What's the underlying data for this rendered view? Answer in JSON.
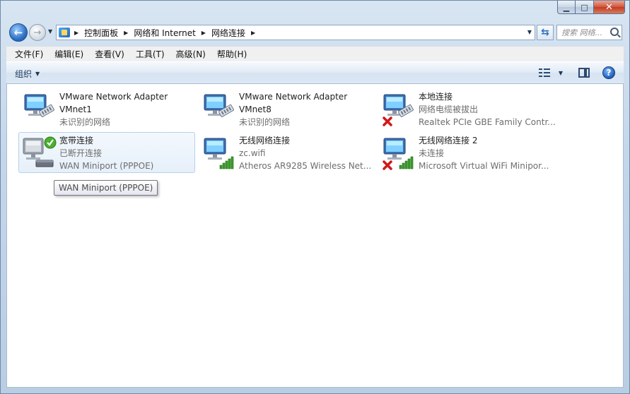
{
  "window": {
    "caption": {
      "minimize": "▁",
      "maximize": "□",
      "close": "✕"
    }
  },
  "nav": {
    "back_icon": "back-arrow-icon",
    "forward_icon": "forward-arrow-icon",
    "breadcrumbs": [
      "控制面板",
      "网络和 Internet",
      "网络连接"
    ],
    "refresh_icon": "refresh-icon",
    "search_placeholder": "搜索 网络..."
  },
  "menu": {
    "items": [
      "文件(F)",
      "编辑(E)",
      "查看(V)",
      "工具(T)",
      "高级(N)",
      "帮助(H)"
    ]
  },
  "toolbar": {
    "organize_label": "组织",
    "help_label": "?"
  },
  "connections": [
    {
      "line1": "VMware Network Adapter",
      "line2": "VMnet1",
      "line3": "未识别的网络",
      "icon": "wired-network-icon",
      "status": "ok"
    },
    {
      "line1": "VMware Network Adapter",
      "line2": "VMnet8",
      "line3": "未识别的网络",
      "icon": "wired-network-icon",
      "status": "ok"
    },
    {
      "line1": "本地连接",
      "line2": "网络电缆被拔出",
      "line3": "Realtek PCIe GBE Family Contr...",
      "icon": "wired-network-icon",
      "status": "disconnected"
    },
    {
      "line1": "宽带连接",
      "line2": "已断开连接",
      "line3": "WAN Miniport (PPPOE)",
      "icon": "broadband-icon",
      "status": "disconnected"
    },
    {
      "line1": "无线网络连接",
      "line2": "zc.wifi",
      "line3": "Atheros AR9285 Wireless Net...",
      "icon": "wireless-network-icon",
      "status": "ok"
    },
    {
      "line1": "无线网络连接 2",
      "line2": "未连接",
      "line3": "Microsoft Virtual WiFi Minipor...",
      "icon": "wireless-network-icon",
      "status": "disconnected"
    }
  ],
  "tooltip": {
    "text": "WAN Miniport (PPPOE)"
  }
}
